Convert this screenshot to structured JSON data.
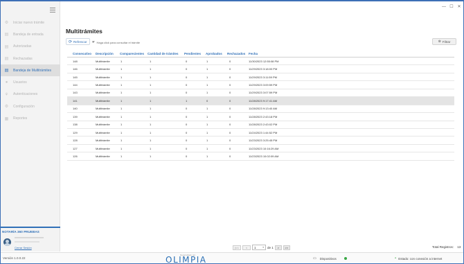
{
  "window": {
    "minimize": "—",
    "maximize": "☐",
    "close": "✕"
  },
  "sidebar": {
    "items": [
      {
        "label": "Iniciar nuevo trámite",
        "icon": "gear-icon",
        "glyph": "⚙"
      },
      {
        "label": "Bandeja de entrada",
        "icon": "document-icon",
        "glyph": "▤"
      },
      {
        "label": "Autorizadas",
        "icon": "document-icon",
        "glyph": "▤"
      },
      {
        "label": "Rechazadas",
        "icon": "document-icon",
        "glyph": "▤"
      },
      {
        "label": "Bandeja de Multitrámites",
        "icon": "document-icon",
        "glyph": "▤"
      },
      {
        "label": "Usuarios",
        "icon": "user-icon",
        "glyph": "●"
      },
      {
        "label": "Autenticaciones",
        "icon": "fingerprint-icon",
        "glyph": "⚘"
      },
      {
        "label": "Configuración",
        "icon": "settings-icon",
        "glyph": "⚙"
      },
      {
        "label": "Reportes",
        "icon": "chart-icon",
        "glyph": "▦"
      }
    ],
    "active_index": 4,
    "org_name": "NOTARÍA 360 PRUEBAS",
    "logout_label": "Cerrar Sesión"
  },
  "main": {
    "title": "Multitrámites",
    "refresh_label": "Refrescar",
    "hint_text": "Haga click para consultar el trámite",
    "filter_label": "Filtrar",
    "columns": [
      "Consecutivo",
      "Descripción",
      "Comparecientes",
      "Cantidad de trámites",
      "Pendientes",
      "Aprobados",
      "Rechazados",
      "Fecha"
    ],
    "rows": [
      [
        "148",
        "Multitrámite",
        "1",
        "1",
        "0",
        "1",
        "0",
        "11/30/2023 12:55:08 PM"
      ],
      [
        "146",
        "Multitrámite",
        "1",
        "1",
        "0",
        "1",
        "0",
        "11/29/2023 3:18:00 PM"
      ],
      [
        "145",
        "Multitrámite",
        "1",
        "1",
        "0",
        "1",
        "0",
        "11/29/2023 3:11:59 PM"
      ],
      [
        "144",
        "Multitrámite",
        "1",
        "1",
        "0",
        "1",
        "0",
        "11/29/2023 3:09:59 PM"
      ],
      [
        "143",
        "Multitrámite",
        "1",
        "1",
        "0",
        "1",
        "0",
        "11/29/2023 3:07:59 PM"
      ],
      [
        "141",
        "Multitrámite",
        "1",
        "1",
        "1",
        "0",
        "0",
        "11/28/2023 9:17:41 AM"
      ],
      [
        "140",
        "Multitrámite",
        "1",
        "1",
        "0",
        "1",
        "0",
        "11/28/2023 9:13:40 AM"
      ],
      [
        "139",
        "Multitrámite",
        "1",
        "1",
        "0",
        "1",
        "0",
        "11/28/2023 2:43:18 PM"
      ],
      [
        "138",
        "Multitrámite",
        "1",
        "1",
        "0",
        "1",
        "0",
        "11/28/2023 2:43:02 PM"
      ],
      [
        "129",
        "Multitrámite",
        "1",
        "1",
        "0",
        "1",
        "0",
        "11/24/2023 1:44:52 PM"
      ],
      [
        "128",
        "Multitrámite",
        "1",
        "1",
        "0",
        "1",
        "0",
        "11/23/2023 3:25:45 PM"
      ],
      [
        "127",
        "Multitrámite",
        "1",
        "1",
        "0",
        "1",
        "0",
        "11/23/2023 10:16:29 AM"
      ],
      [
        "126",
        "Multitrámite",
        "1",
        "1",
        "0",
        "1",
        "0",
        "11/23/2023 10:02:09 AM"
      ]
    ],
    "selected_row": 5
  },
  "pager": {
    "first": "|<<",
    "prev": "<",
    "page": "1",
    "of_text": "de 1",
    "next": ">",
    "last": ">>",
    "total_label": "Total Registros:",
    "total_value": "13"
  },
  "footer": {
    "version": "Versión 1.0.0.22",
    "developed_by": "Desarrollado por",
    "brand": "OLIMPIA",
    "devices_label": "Dispositivos",
    "status_label": "Estado: con conexión a internet",
    "status_color": "#39a845",
    "accent": "#2f6fb7"
  }
}
